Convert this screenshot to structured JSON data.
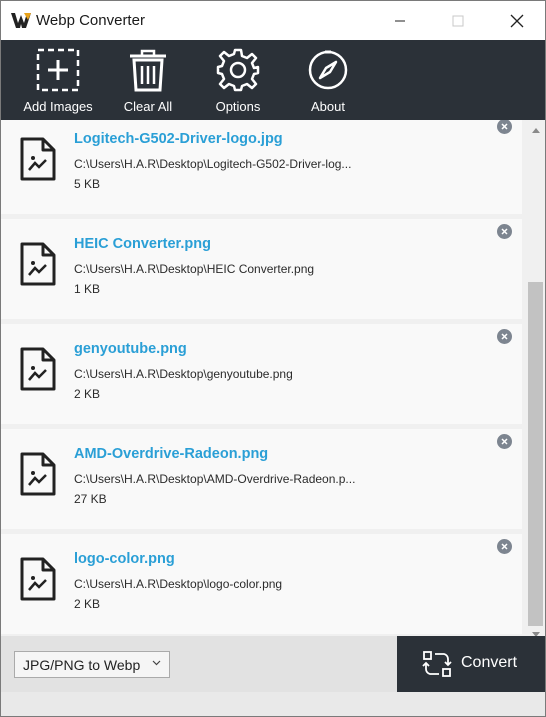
{
  "window": {
    "title": "Webp Converter",
    "icons": [
      "app-logo-icon",
      "minimize-icon",
      "maximize-icon",
      "close-icon"
    ]
  },
  "toolbar": {
    "items": [
      {
        "label": "Add Images",
        "icon": "add-icon"
      },
      {
        "label": "Clear All",
        "icon": "trash-icon"
      },
      {
        "label": "Options",
        "icon": "gear-icon"
      },
      {
        "label": "About",
        "icon": "compass-icon"
      }
    ]
  },
  "files": [
    {
      "name": "Logitech-G502-Driver-logo.jpg",
      "path": "C:\\Users\\H.A.R\\Desktop\\Logitech-G502-Driver-log...",
      "size": "5 KB"
    },
    {
      "name": "HEIC Converter.png",
      "path": "C:\\Users\\H.A.R\\Desktop\\HEIC Converter.png",
      "size": "1 KB"
    },
    {
      "name": "genyoutube.png",
      "path": "C:\\Users\\H.A.R\\Desktop\\genyoutube.png",
      "size": "2 KB"
    },
    {
      "name": "AMD-Overdrive-Radeon.png",
      "path": "C:\\Users\\H.A.R\\Desktop\\AMD-Overdrive-Radeon.p...",
      "size": "27 KB"
    },
    {
      "name": "logo-color.png",
      "path": "C:\\Users\\H.A.R\\Desktop\\logo-color.png",
      "size": "2 KB"
    }
  ],
  "bottom": {
    "mode_selected": "JPG/PNG to Webp",
    "convert_label": "Convert"
  },
  "colors": {
    "toolbar_bg": "#2b3138",
    "file_name": "#2a9fd6",
    "remove_badge": "#7d8590"
  }
}
